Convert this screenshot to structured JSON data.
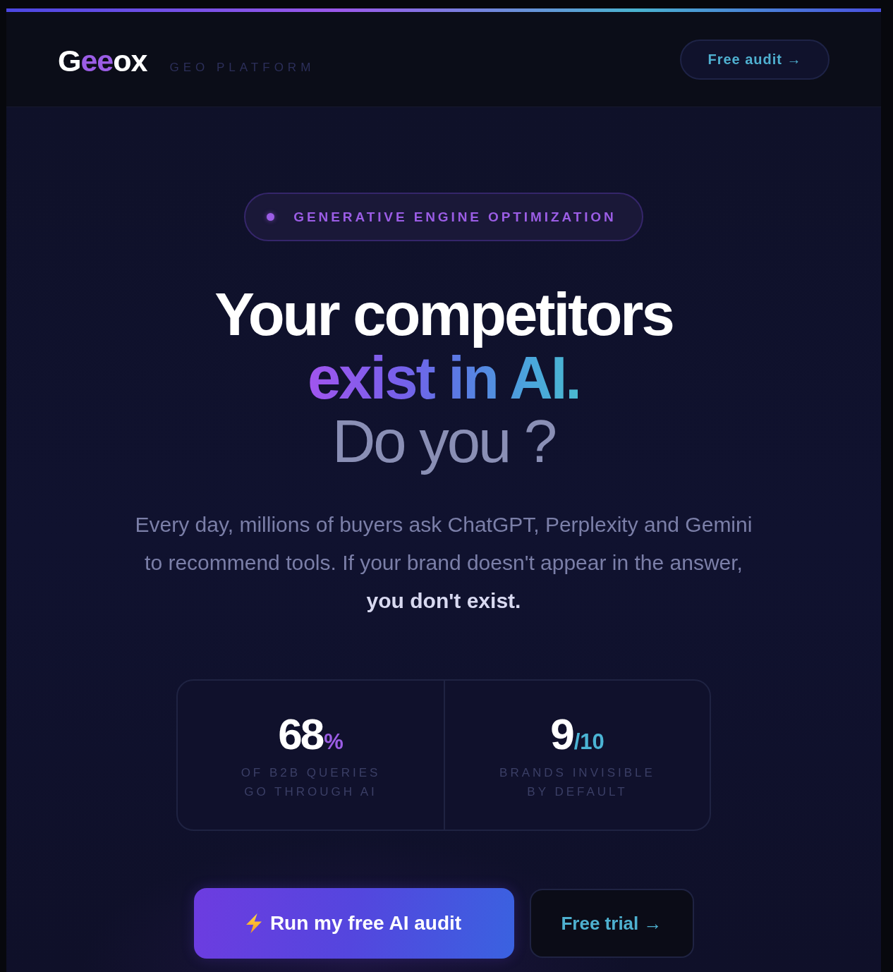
{
  "header": {
    "logo": "G**ee**ox",
    "tagline": "GEO PLATFORM",
    "cta": "Free audit →"
  },
  "hero": {
    "badge": "GENERATIVE ENGINE OPTIMIZATION",
    "headline": [
      {
        "text": "Your competitors",
        "kind": "plain"
      },
      {
        "text": "exist in AI.",
        "kind": "gradient"
      },
      {
        "text": "Do you ?",
        "kind": "muted"
      }
    ],
    "intro": "Every day, millions of buyers ask ChatGPT, Perplexity and Gemini to recommend tools. If your brand doesn't appear in the answer, **you don't exist.**"
  },
  "stats": [
    {
      "value": "68",
      "unit": "%",
      "color": "#9b5de5",
      "label": "OF B2B QUERIES GO THROUGH AI"
    },
    {
      "value": "9",
      "unit": "/10",
      "color": "#4bb4d4",
      "label": "BRANDS INVISIBLE BY DEFAULT"
    }
  ],
  "actions": [
    {
      "label": "Run my free AI audit",
      "kind": "primary"
    },
    {
      "label": "Free trial →",
      "kind": "secondary"
    }
  ]
}
